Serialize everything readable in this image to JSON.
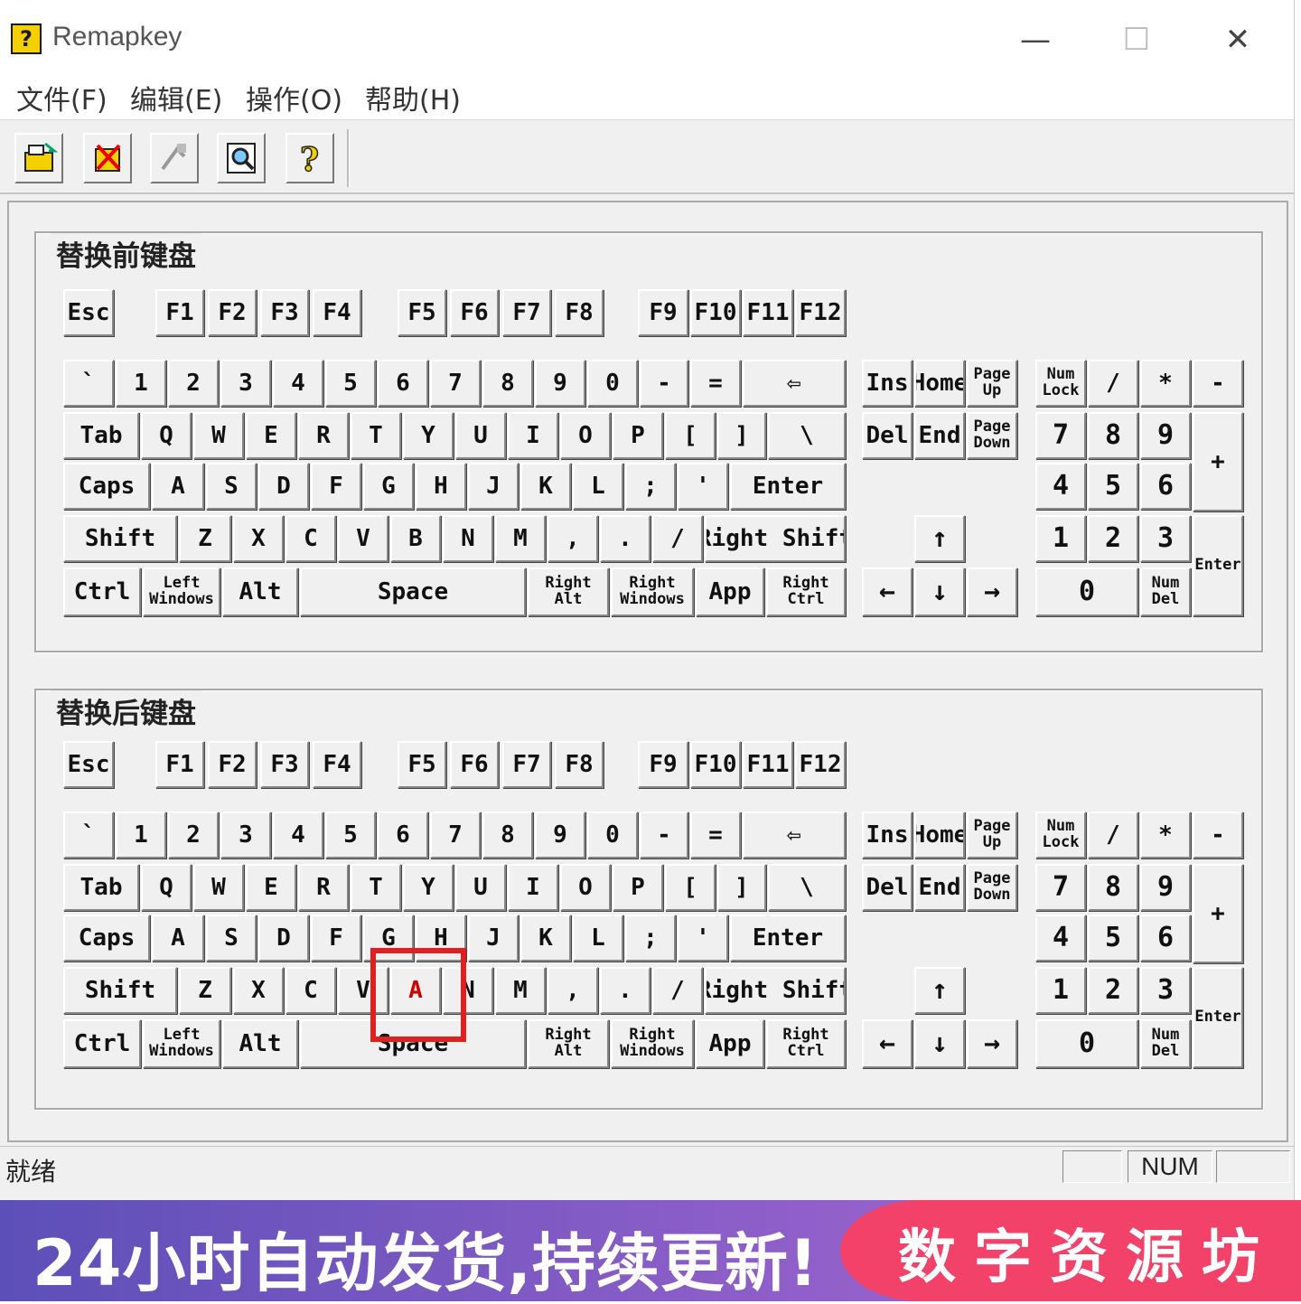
{
  "window": {
    "title": "Remapkey",
    "icon": "help-question-icon",
    "controls": {
      "minimize": "—",
      "maximize": "☐",
      "close": "✕"
    }
  },
  "menu": [
    "文件(F)",
    "编辑(E)",
    "操作(O)",
    "帮助(H)"
  ],
  "toolbar": [
    {
      "name": "open-icon"
    },
    {
      "name": "delete-icon"
    },
    {
      "name": "remap-icon"
    },
    {
      "name": "preview-icon"
    },
    {
      "name": "help-icon"
    }
  ],
  "groups": {
    "before": "替换前键盘",
    "after": "替换后键盘"
  },
  "keys": {
    "esc": "Esc",
    "f1": "F1",
    "f2": "F2",
    "f3": "F3",
    "f4": "F4",
    "f5": "F5",
    "f6": "F6",
    "f7": "F7",
    "f8": "F8",
    "f9": "F9",
    "f10": "F10",
    "f11": "F11",
    "f12": "F12",
    "backtick": "`",
    "n1": "1",
    "n2": "2",
    "n3": "3",
    "n4": "4",
    "n5": "5",
    "n6": "6",
    "n7": "7",
    "n8": "8",
    "n9": "9",
    "n0": "0",
    "minus": "-",
    "equals": "=",
    "backspace": "⇦",
    "tab": "Tab",
    "q": "Q",
    "w": "W",
    "e": "E",
    "r": "R",
    "t": "T",
    "y": "Y",
    "u": "U",
    "i": "I",
    "o": "O",
    "p": "P",
    "lbracket": "[",
    "rbracket": "]",
    "backslash": "\\",
    "caps": "Caps",
    "a": "A",
    "s": "S",
    "d": "D",
    "f": "F",
    "g": "G",
    "h": "H",
    "j": "J",
    "k": "K",
    "l": "L",
    "semicolon": ";",
    "quote": "'",
    "enter": "Enter",
    "shift": "Shift",
    "z": "Z",
    "x": "X",
    "c": "C",
    "v": "V",
    "b": "B",
    "n": "N",
    "m": "M",
    "comma": ",",
    "period": ".",
    "slash": "/",
    "rshift": "Right Shift",
    "ctrl": "Ctrl",
    "lwin": "Left Windows",
    "alt": "Alt",
    "space": "Space",
    "ralt": "Right Alt",
    "rwin": "Right Windows",
    "app": "App",
    "rctrl": "Right Ctrl",
    "ins": "Ins",
    "home": "Home",
    "pgup": "Page Up",
    "del": "Del",
    "end": "End",
    "pgdn": "Page Down",
    "up": "↑",
    "left": "←",
    "down": "↓",
    "right": "→",
    "numlock": "Num Lock",
    "kpdiv": "/",
    "kpmul": "*",
    "kpminus": "-",
    "kpplus": "+",
    "kp7": "7",
    "kp8": "8",
    "kp9": "9",
    "kp4": "4",
    "kp5": "5",
    "kp6": "6",
    "kp1": "1",
    "kp2": "2",
    "kp3": "3",
    "kp0": "0",
    "kpdel": "Num Del",
    "kpenter": "Enter"
  },
  "remapped": {
    "b": "A"
  },
  "status": {
    "text": "就绪",
    "panel2": "NUM"
  },
  "banner": {
    "left": "24小时自动发货,持续更新!",
    "right": "数字资源坊"
  }
}
